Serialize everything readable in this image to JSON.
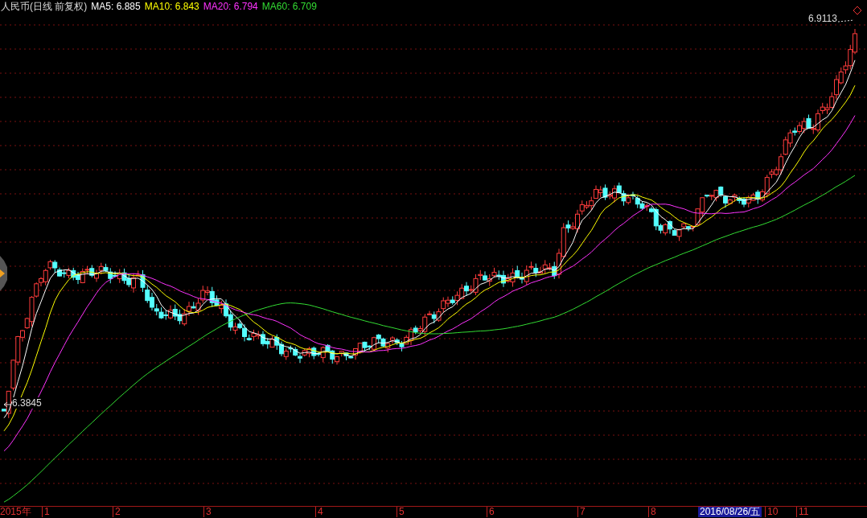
{
  "header": {
    "title": "人民币(日线 前复权)",
    "indicators": [
      {
        "label": "MA5: 6.885",
        "color": "#ffffff"
      },
      {
        "label": "MA10: 6.843",
        "color": "#ffff00"
      },
      {
        "label": "MA20: 6.794",
        "color": "#ff33ff"
      },
      {
        "label": "MA60: 6.709",
        "color": "#33dd33"
      }
    ]
  },
  "price_labels": [
    {
      "kind": "high",
      "text": "6.9113"
    },
    {
      "kind": "low",
      "text": "6.3845"
    }
  ],
  "x_axis": [
    {
      "kind": "year",
      "text": "2015年"
    },
    {
      "kind": "month",
      "text": "1"
    },
    {
      "kind": "month",
      "text": "2"
    },
    {
      "kind": "month",
      "text": "3"
    },
    {
      "kind": "month",
      "text": "4"
    },
    {
      "kind": "month",
      "text": "5"
    },
    {
      "kind": "month",
      "text": "6"
    },
    {
      "kind": "month",
      "text": "7"
    },
    {
      "kind": "month",
      "text": "8"
    },
    {
      "kind": "cursor",
      "text": "2016/08/26/五"
    },
    {
      "kind": "month",
      "text": "10"
    },
    {
      "kind": "month",
      "text": "11"
    }
  ]
}
